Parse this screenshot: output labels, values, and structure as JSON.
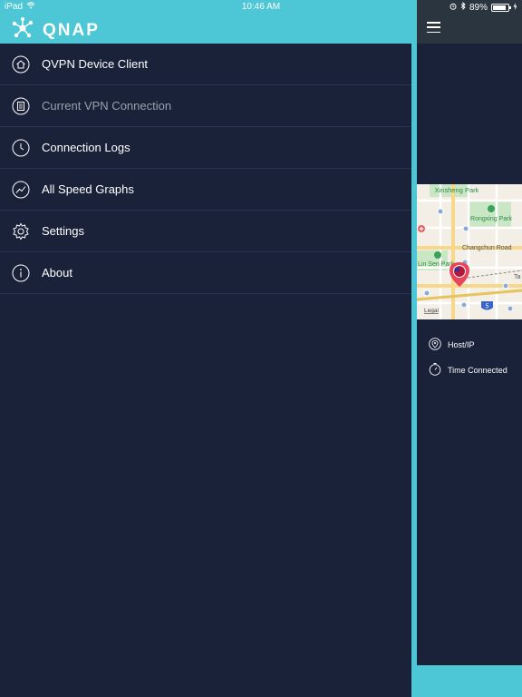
{
  "status_bar": {
    "device": "iPad",
    "time": "10:46 AM",
    "battery": "89%",
    "battery_level": 0.89
  },
  "brand": {
    "logo_text": "QNAP",
    "header_color": "#4dc6d6"
  },
  "menu": {
    "items": [
      {
        "label": "QVPN Device Client",
        "icon": "home-icon"
      },
      {
        "label": "Current VPN Connection",
        "icon": "document-list-icon"
      },
      {
        "label": "Connection Logs",
        "icon": "clock-icon"
      },
      {
        "label": "All Speed Graphs",
        "icon": "trend-line-icon"
      },
      {
        "label": "Settings",
        "icon": "gear-icon"
      },
      {
        "label": "About",
        "icon": "info-icon"
      }
    ]
  },
  "map": {
    "labels": {
      "park1": "Xinsheng Park",
      "park2": "Rongxing Park",
      "road": "Changchun Road",
      "park3": "Lin Sen Park",
      "legal": "Legal",
      "shield": "5",
      "edge": "Ta"
    }
  },
  "info": {
    "host_label": "Host/IP",
    "time_label": "Time Connected"
  }
}
